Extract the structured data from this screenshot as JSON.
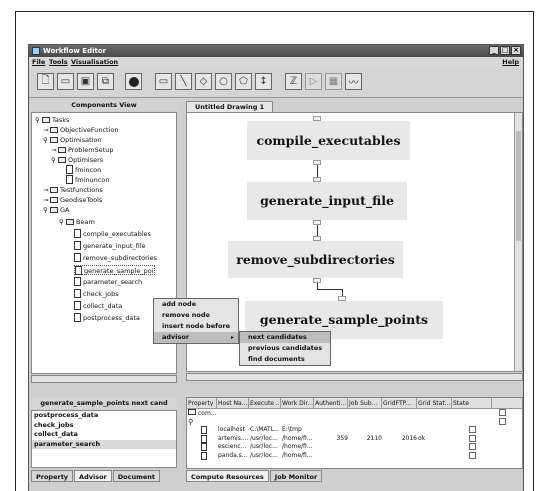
{
  "window": {
    "title": "Workflow Editor"
  },
  "menubar": {
    "file": "File",
    "tools": "Tools",
    "visualisation": "Visualisation",
    "help": "Help"
  },
  "toolbar": {
    "buttons": [
      "new-file-icon",
      "open-folder-icon",
      "save-icon",
      "copy-icon",
      "record-icon",
      "rectangle-icon",
      "line-icon",
      "diamond-icon",
      "circle-icon",
      "shield-icon",
      "cursor-icon",
      "script-icon",
      "play-icon",
      "grid-icon",
      "graph-icon"
    ]
  },
  "left_panel": {
    "title": "Components View"
  },
  "tree": {
    "tasks": "Tasks",
    "objective_function": "ObjectiveFunction",
    "optimisation": "Optimisation",
    "problem_setup": "ProblemSetup",
    "optimisers": "Optimisers",
    "fmincon": "fmincon",
    "fminuncon": "fminuncon",
    "testfunctions": "Testfunctions",
    "geodise_tools": "GeodiseTools",
    "ga": "GA",
    "beam": "Beam",
    "compile_executables": "compile_executables",
    "generate_input_file": "generate_input_file",
    "remove_subdirectories": "remove_subdirectories",
    "generate_sample": "generate_sample_poi",
    "parameter_search": "parameter_search",
    "check_jobs": "check_jobs",
    "collect_data": "collect_data",
    "postprocess_data": "postprocess_data"
  },
  "drawing": {
    "tab": "Untitled Drawing 1",
    "nodes": [
      "compile_executables",
      "generate_input_file",
      "remove_subdirectories",
      "generate_sample_points"
    ]
  },
  "context_menu": {
    "items": [
      "add node",
      "remove node",
      "insert node before",
      "advisor"
    ],
    "submenu": [
      "next candidates",
      "previous candidates",
      "find documents"
    ]
  },
  "advisor_panel": {
    "title": "generate_sample_points next cand",
    "items": [
      "postprocess_data",
      "check_jobs",
      "collect_data",
      "parameter_search"
    ]
  },
  "bottom_left_tabs": [
    "Property",
    "Advisor",
    "Document"
  ],
  "resources": {
    "columns": [
      "Property",
      "Host Na...",
      "Execute ...",
      "Work Dir...",
      "Authenti...",
      "Job Sub...",
      "GridFTP...",
      "Grid Stat...",
      "State"
    ],
    "root_label": "com...",
    "rows": [
      [
        "localhost",
        "C:\\MATL...",
        "E:\\tmp",
        "",
        "",
        "",
        ""
      ],
      [
        "artemis....",
        "/usr/loc...",
        "/home/fi...",
        "359",
        "2110",
        "2016",
        "ok"
      ],
      [
        "escienc...",
        "/usr/loc...",
        "/home/fi...",
        "",
        "",
        "",
        ""
      ],
      [
        "panda.s...",
        "/usr/loc...",
        "/home/fi...",
        "",
        "",
        "",
        ""
      ]
    ]
  },
  "bottom_right_tabs": [
    "Compute Resources",
    "Job Monitor"
  ]
}
